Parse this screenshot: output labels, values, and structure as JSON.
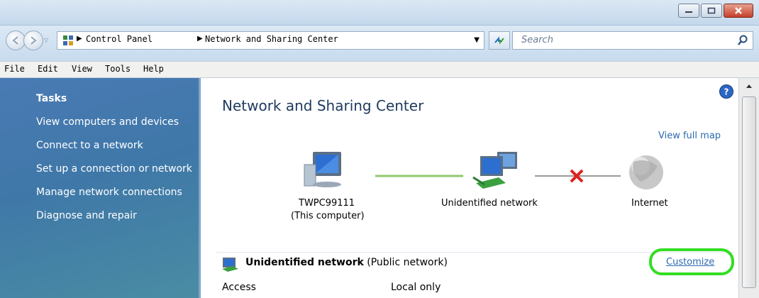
{
  "window": {
    "controls": {
      "minimize": "minimize",
      "maximize": "maximize",
      "close": "close"
    }
  },
  "address_bar": {
    "breadcrumb": [
      "Control Panel",
      "Network and Sharing Center"
    ],
    "search_placeholder": "Search"
  },
  "menu": [
    "File",
    "Edit",
    "View",
    "Tools",
    "Help"
  ],
  "tasks": {
    "title": "Tasks",
    "items": [
      "View computers and devices",
      "Connect to a network",
      "Set up a connection or network",
      "Manage network connections",
      "Diagnose and repair"
    ]
  },
  "main": {
    "title": "Network and Sharing Center",
    "view_full_map": "View full map",
    "map": {
      "computer_name": "TWPC99111",
      "computer_caption": "(This computer)",
      "network_name": "Unidentified network",
      "internet_label": "Internet"
    },
    "network_section": {
      "name": "Unidentified network",
      "type": "(Public network)",
      "customize": "Customize",
      "access_label": "Access",
      "access_value": "Local only"
    }
  },
  "colors": {
    "task_pane": "#3f78a8",
    "link": "#2c6ab0",
    "highlight": "#33dd22",
    "disconnect_x": "#e02020",
    "link_line": "#8fc870"
  },
  "icons": [
    "back-arrow-icon",
    "forward-arrow-icon",
    "control-panel-icon",
    "refresh-icon",
    "search-icon",
    "help-icon",
    "computer-icon",
    "network-icon",
    "globe-icon",
    "disconnected-x-icon",
    "network-small-icon"
  ]
}
